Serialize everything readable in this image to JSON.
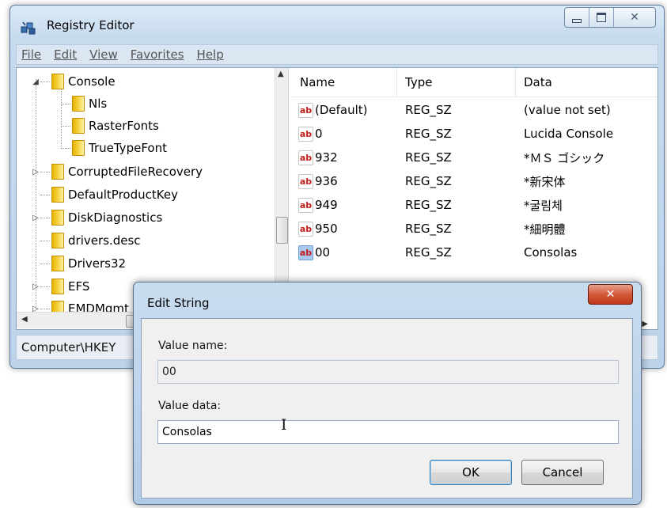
{
  "window": {
    "title": "Registry Editor",
    "icon": "regedit-cubes-icon",
    "controls": {
      "minimize": "minimize",
      "maximize": "maximize",
      "close": "✕"
    }
  },
  "menu": [
    {
      "label": "File"
    },
    {
      "label": "Edit"
    },
    {
      "label": "View"
    },
    {
      "label": "Favorites"
    },
    {
      "label": "Help"
    }
  ],
  "tree": {
    "items": [
      {
        "label": "Console",
        "expander": "◢",
        "level": 0
      },
      {
        "label": "Nls",
        "expander": "",
        "level": 1
      },
      {
        "label": "RasterFonts",
        "expander": "",
        "level": 1
      },
      {
        "label": "TrueTypeFont",
        "expander": "",
        "level": 1
      },
      {
        "label": "CorruptedFileRecovery",
        "expander": "▷",
        "level": 0
      },
      {
        "label": "DefaultProductKey",
        "expander": "",
        "level": 0
      },
      {
        "label": "DiskDiagnostics",
        "expander": "▷",
        "level": 0
      },
      {
        "label": "drivers.desc",
        "expander": "",
        "level": 0
      },
      {
        "label": "Drivers32",
        "expander": "",
        "level": 0
      },
      {
        "label": "EFS",
        "expander": "▷",
        "level": 0
      },
      {
        "label": "EMDMgmt",
        "expander": "▷",
        "level": 0
      }
    ]
  },
  "list": {
    "columns": {
      "name": "Name",
      "type": "Type",
      "data": "Data"
    },
    "rows": [
      {
        "name": "(Default)",
        "type": "REG_SZ",
        "data": "(value not set)",
        "icon": "ab",
        "selected": false
      },
      {
        "name": "0",
        "type": "REG_SZ",
        "data": "Lucida Console",
        "icon": "ab",
        "selected": false
      },
      {
        "name": "932",
        "type": "REG_SZ",
        "data": "*ＭＳ ゴシック",
        "icon": "ab",
        "selected": false
      },
      {
        "name": "936",
        "type": "REG_SZ",
        "data": "*新宋体",
        "icon": "ab",
        "selected": false
      },
      {
        "name": "949",
        "type": "REG_SZ",
        "data": "*굴림체",
        "icon": "ab",
        "selected": false
      },
      {
        "name": "950",
        "type": "REG_SZ",
        "data": "*細明體",
        "icon": "ab",
        "selected": false
      },
      {
        "name": "00",
        "type": "REG_SZ",
        "data": "Consolas",
        "icon": "ab",
        "selected": true
      }
    ]
  },
  "status": {
    "path": "Computer\\HKEY"
  },
  "dialog": {
    "title": "Edit String",
    "close": "✕",
    "value_name_label": "Value name:",
    "value_name": "00",
    "value_data_label": "Value data:",
    "value_data": "Consolas",
    "ok_label": "OK",
    "cancel_label": "Cancel"
  }
}
